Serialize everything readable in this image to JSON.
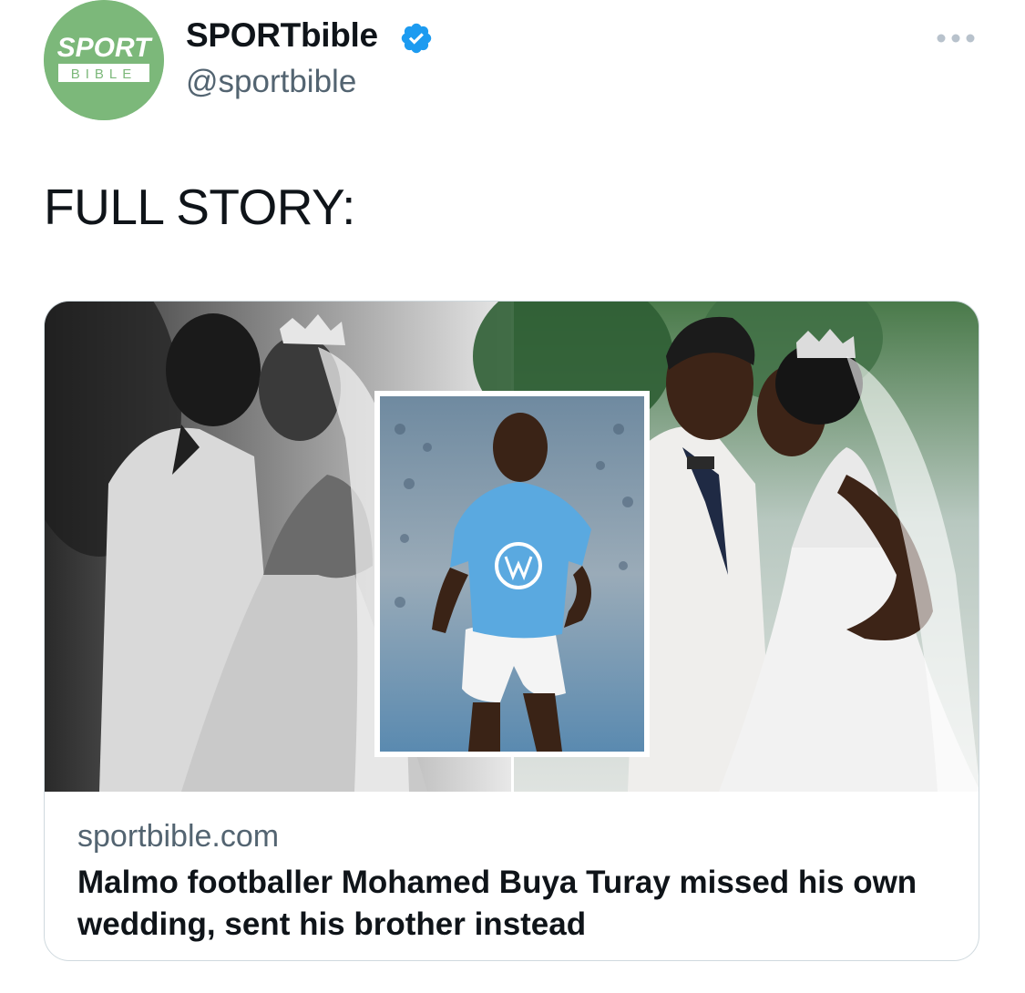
{
  "account": {
    "display_name": "SPORTbible",
    "handle": "@sportbible",
    "verified": true,
    "avatar_logo_top": "SPORT",
    "avatar_logo_bottom": "BIBLE",
    "avatar_color": "#7cb87a"
  },
  "tweet": {
    "text": "FULL STORY:"
  },
  "card": {
    "domain": "sportbible.com",
    "title": "Malmo footballer Mohamed Buya Turay missed his own wedding, sent his brother instead"
  },
  "icons": {
    "verified": "verified-badge-icon",
    "more": "more-options-icon"
  },
  "colors": {
    "verified_blue": "#1d9bf0",
    "secondary_text": "#536471",
    "jersey_blue": "#5aa9e0"
  }
}
